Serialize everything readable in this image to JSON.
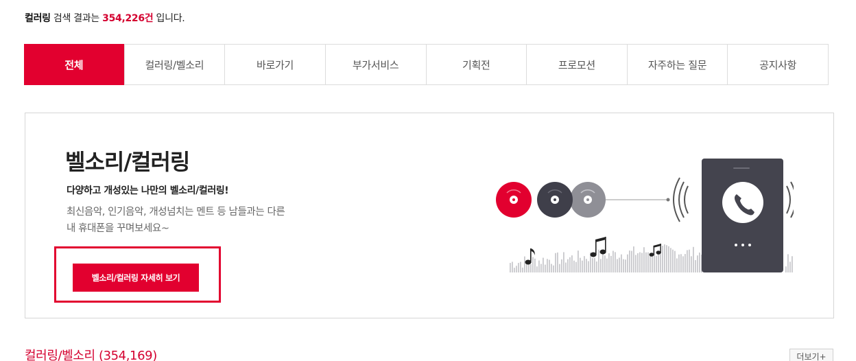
{
  "summary": {
    "query": "컬러링",
    "text_before": "검색 결과는",
    "count": "354,226건",
    "text_after": "입니다."
  },
  "tabs": [
    {
      "label": "전체",
      "active": true
    },
    {
      "label": "컬러링/벨소리",
      "active": false
    },
    {
      "label": "바로가기",
      "active": false
    },
    {
      "label": "부가서비스",
      "active": false
    },
    {
      "label": "기획전",
      "active": false
    },
    {
      "label": "프로모션",
      "active": false
    },
    {
      "label": "자주하는 질문",
      "active": false
    },
    {
      "label": "공지사항",
      "active": false
    }
  ],
  "banner": {
    "title": "벨소리/컬러링",
    "subtitle": "다양하고 개성있는 나만의 벨소리/컬러링!",
    "desc_line1": "최신음악, 인기음악, 개성넘치는 멘트 등 남들과는 다른",
    "desc_line2": "내 휴대폰을 꾸며보세요~",
    "button_label": "벨소리/컬러링 자세히 보기"
  },
  "section": {
    "title": "컬러링/벨소리",
    "count": "(354,169)",
    "more_label": "더보기+"
  },
  "colors": {
    "accent": "#e2002f",
    "disc_dark": "#3f3f4a",
    "disc_gray": "#8f8f96",
    "phone": "#44444e"
  },
  "icons": [
    "vinyl-disc-icon",
    "music-note-icon",
    "phone-call-icon",
    "sound-wave-icon"
  ]
}
